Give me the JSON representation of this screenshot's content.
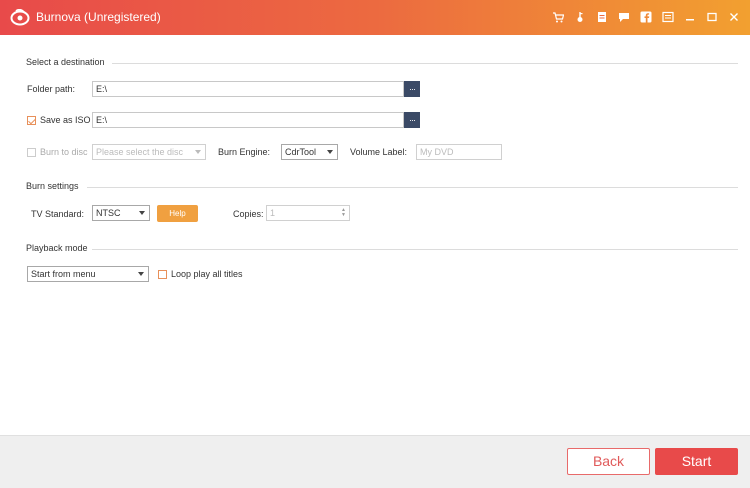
{
  "titlebar": {
    "title": "Burnova (Unregistered)",
    "icons": [
      "cart-icon",
      "key-icon",
      "document-icon",
      "feedback-icon",
      "facebook-icon",
      "menu-icon",
      "minimize-icon",
      "maximize-icon",
      "close-icon"
    ]
  },
  "destination": {
    "section_title": "Select a destination",
    "folder_path_label": "Folder path:",
    "folder_path_value": "E:\\",
    "save_iso_label": "Save as ISO",
    "save_iso_checked": true,
    "save_iso_value": "E:\\",
    "burn_to_disc_label": "Burn to disc",
    "burn_to_disc_checked": false,
    "disc_placeholder": "Please select the disc",
    "burn_engine_label": "Burn Engine:",
    "burn_engine_value": "CdrTool",
    "volume_label_label": "Volume Label:",
    "volume_label_placeholder": "My DVD",
    "browse_label": "···"
  },
  "burn_settings": {
    "section_title": "Burn settings",
    "tv_standard_label": "TV Standard:",
    "tv_standard_value": "NTSC",
    "help_label": "Help",
    "copies_label": "Copies:",
    "copies_value": "1"
  },
  "playback": {
    "section_title": "Playback mode",
    "mode_value": "Start from menu",
    "loop_label": "Loop play all titles",
    "loop_checked": false
  },
  "footer": {
    "back_label": "Back",
    "start_label": "Start"
  },
  "colors": {
    "accent": "#e84a4a",
    "title_gradient_end": "#f2a030",
    "help_orange": "#f0a040",
    "browse_navy": "#3b4a66"
  }
}
